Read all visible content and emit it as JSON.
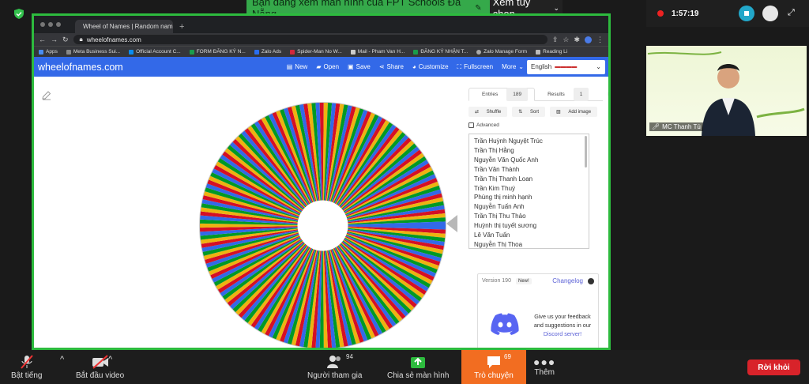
{
  "banner": {
    "text": "Bạn đang xem màn hình của FPT Schools Đà Nẵng",
    "option": "Xem tùy chọn"
  },
  "browser": {
    "tab_title": "Wheel of Names | Random nam",
    "url": "wheelofnames.com",
    "bookmarks": [
      "Apps",
      "Meta Business Sui...",
      "Official Account C...",
      "FORM ĐĂNG KÝ N...",
      "Zalo Ads",
      "Spider-Man No W...",
      "Mail - Pham Van H...",
      "ĐĂNG KÝ NHẬN T...",
      "Zalo Manage Form",
      "Reading Li"
    ]
  },
  "site": {
    "logo": "wheelofnames.com",
    "menu": [
      "New",
      "Open",
      "Save",
      "Share",
      "Customize",
      "Fullscreen",
      "More"
    ],
    "language": "English"
  },
  "panel": {
    "tabs": [
      {
        "label": "Entries",
        "count": "189"
      },
      {
        "label": "Results",
        "count": "1"
      },
      {
        "label": "Hide",
        "count": ""
      }
    ],
    "tools": [
      "Shuffle",
      "Sort",
      "Add image"
    ],
    "advanced": "Advanced",
    "entries": [
      "Trần Huỳnh Nguyệt Trúc",
      "Trần Thị Hằng",
      "Nguyễn Văn Quốc Anh",
      "Trần Văn Thành",
      "Trần Thị Thanh Loan",
      "Trần Kim Thuý",
      "Phùng thị minh hạnh",
      "Nguyễn Tuấn Anh",
      "Trần Thị Thu Thảo",
      "Huỳnh thị tuyết sương",
      "Lê Văn Tuấn",
      "Nguyễn Thị Thoa"
    ],
    "version": "Version 190",
    "new_badge": "New!",
    "changelog": "Changelog",
    "feedback_line1": "Give us your feedback",
    "feedback_line2": "and suggestions in our",
    "feedback_link": "Discord server!"
  },
  "wheel": {
    "colors": [
      "#3369e8",
      "#d50f25",
      "#eeb211",
      "#009925"
    ]
  },
  "zoom": {
    "recording_time": "1:57:19",
    "participant_name": "MC Thanh Tú",
    "toolbar": {
      "mute": "Bật tiếng",
      "video": "Bắt đầu video",
      "participants": "Người tham gia",
      "participants_count": "94",
      "share": "Chia sẻ màn hình",
      "chat": "Trò chuyện",
      "chat_count": "69",
      "more": "Thêm",
      "leave": "Rời khỏi"
    }
  }
}
